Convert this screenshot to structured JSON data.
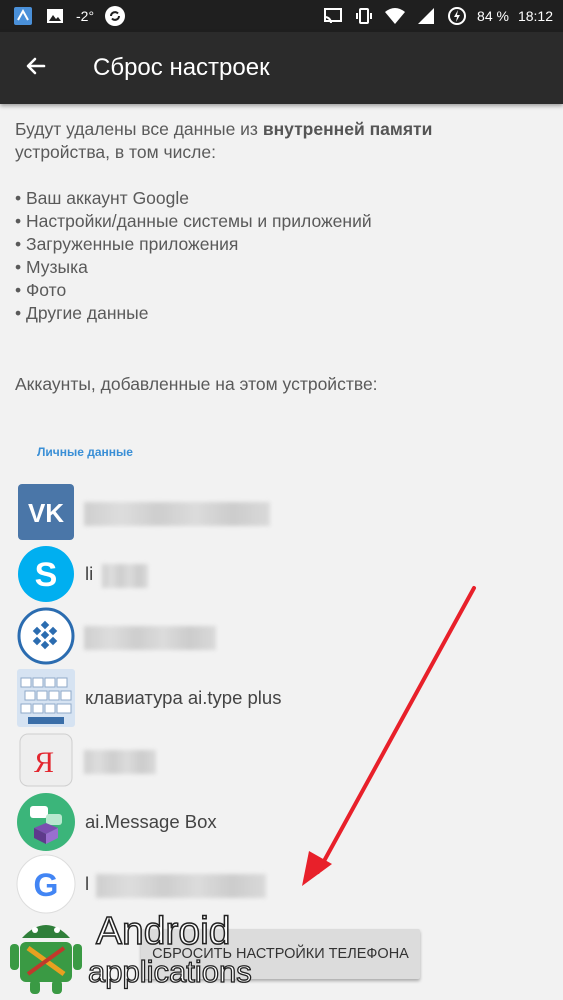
{
  "status_bar": {
    "signal_text": "-2°",
    "battery": "84 %",
    "time": "18:12"
  },
  "toolbar": {
    "back_icon": "arrow-left-icon",
    "title": "Сброс настроек"
  },
  "content": {
    "intro_plain": "Будут удалены все данные из ",
    "intro_bold": "внутренней памяти",
    "intro_tail": "устройства, в том числе:",
    "bullets": [
      "Ваш аккаунт Google",
      "Настройки/данные системы и приложений",
      "Загруженные приложения",
      "Музыка",
      "Фото",
      "Другие данные"
    ],
    "accounts_heading": "Аккаунты, добавленные на этом устройстве:",
    "section_label": "Личные данные"
  },
  "accounts": [
    {
      "icon": "vk-icon",
      "name": "",
      "name_blurred": true
    },
    {
      "icon": "skype-icon",
      "name": "li",
      "name_blurred": true
    },
    {
      "icon": "webmoney-icon",
      "name": "",
      "name_blurred": true
    },
    {
      "icon": "ai-type-keyboard-icon",
      "name": "клавиатура ai.type plus",
      "name_blurred": false
    },
    {
      "icon": "yandex-icon",
      "name": "",
      "name_blurred": true
    },
    {
      "icon": "ai-message-box-icon",
      "name": "ai.Message Box",
      "name_blurred": false
    },
    {
      "icon": "google-icon",
      "name": "l",
      "name_blurred": true
    }
  ],
  "reset_button": {
    "label": "СБРОСИТЬ НАСТРОЙКИ ТЕЛЕФОНА"
  },
  "watermark": {
    "line1": "Android",
    "line2": "applications"
  },
  "colors": {
    "status_bar": "#1f1f1f",
    "toolbar": "#2b2b2b",
    "background": "#f2f2f2",
    "section_label": "#3a8fd6",
    "arrow": "#e8202a"
  }
}
